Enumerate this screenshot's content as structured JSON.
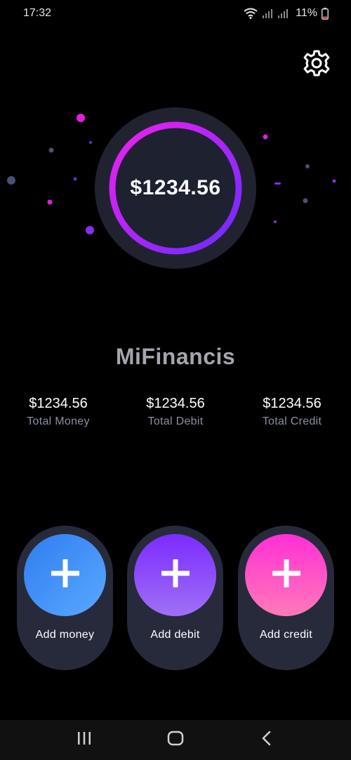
{
  "status_bar": {
    "time": "17:32",
    "battery_percent": "11%",
    "icons": [
      "wifi-icon",
      "signal-icon",
      "signal-icon",
      "battery-icon"
    ]
  },
  "header": {
    "settings_icon": "gear-icon"
  },
  "balance": {
    "amount": "$1234.56"
  },
  "app": {
    "name": "MiFinancis"
  },
  "stats": [
    {
      "value": "$1234.56",
      "label": "Total Money"
    },
    {
      "value": "$1234.56",
      "label": "Total Debit"
    },
    {
      "value": "$1234.56",
      "label": "Total Credit"
    }
  ],
  "actions": [
    {
      "label": "Add money",
      "icon": "plus-icon",
      "gradient": [
        "#2f7df0",
        "#5aa8ff"
      ]
    },
    {
      "label": "Add debit",
      "icon": "plus-icon",
      "gradient": [
        "#7b2bff",
        "#a070f5"
      ]
    },
    {
      "label": "Add credit",
      "icon": "plus-icon",
      "gradient": [
        "#ff2fd6",
        "#ff7ab8"
      ]
    }
  ],
  "nav": {
    "icons": [
      "recent-apps-icon",
      "home-icon",
      "back-icon"
    ]
  },
  "colors": {
    "background": "#000000",
    "card": "#262a3b",
    "ring_start": "#e020f0",
    "ring_end": "#7b2bff",
    "muted_text": "#8c90a3"
  }
}
